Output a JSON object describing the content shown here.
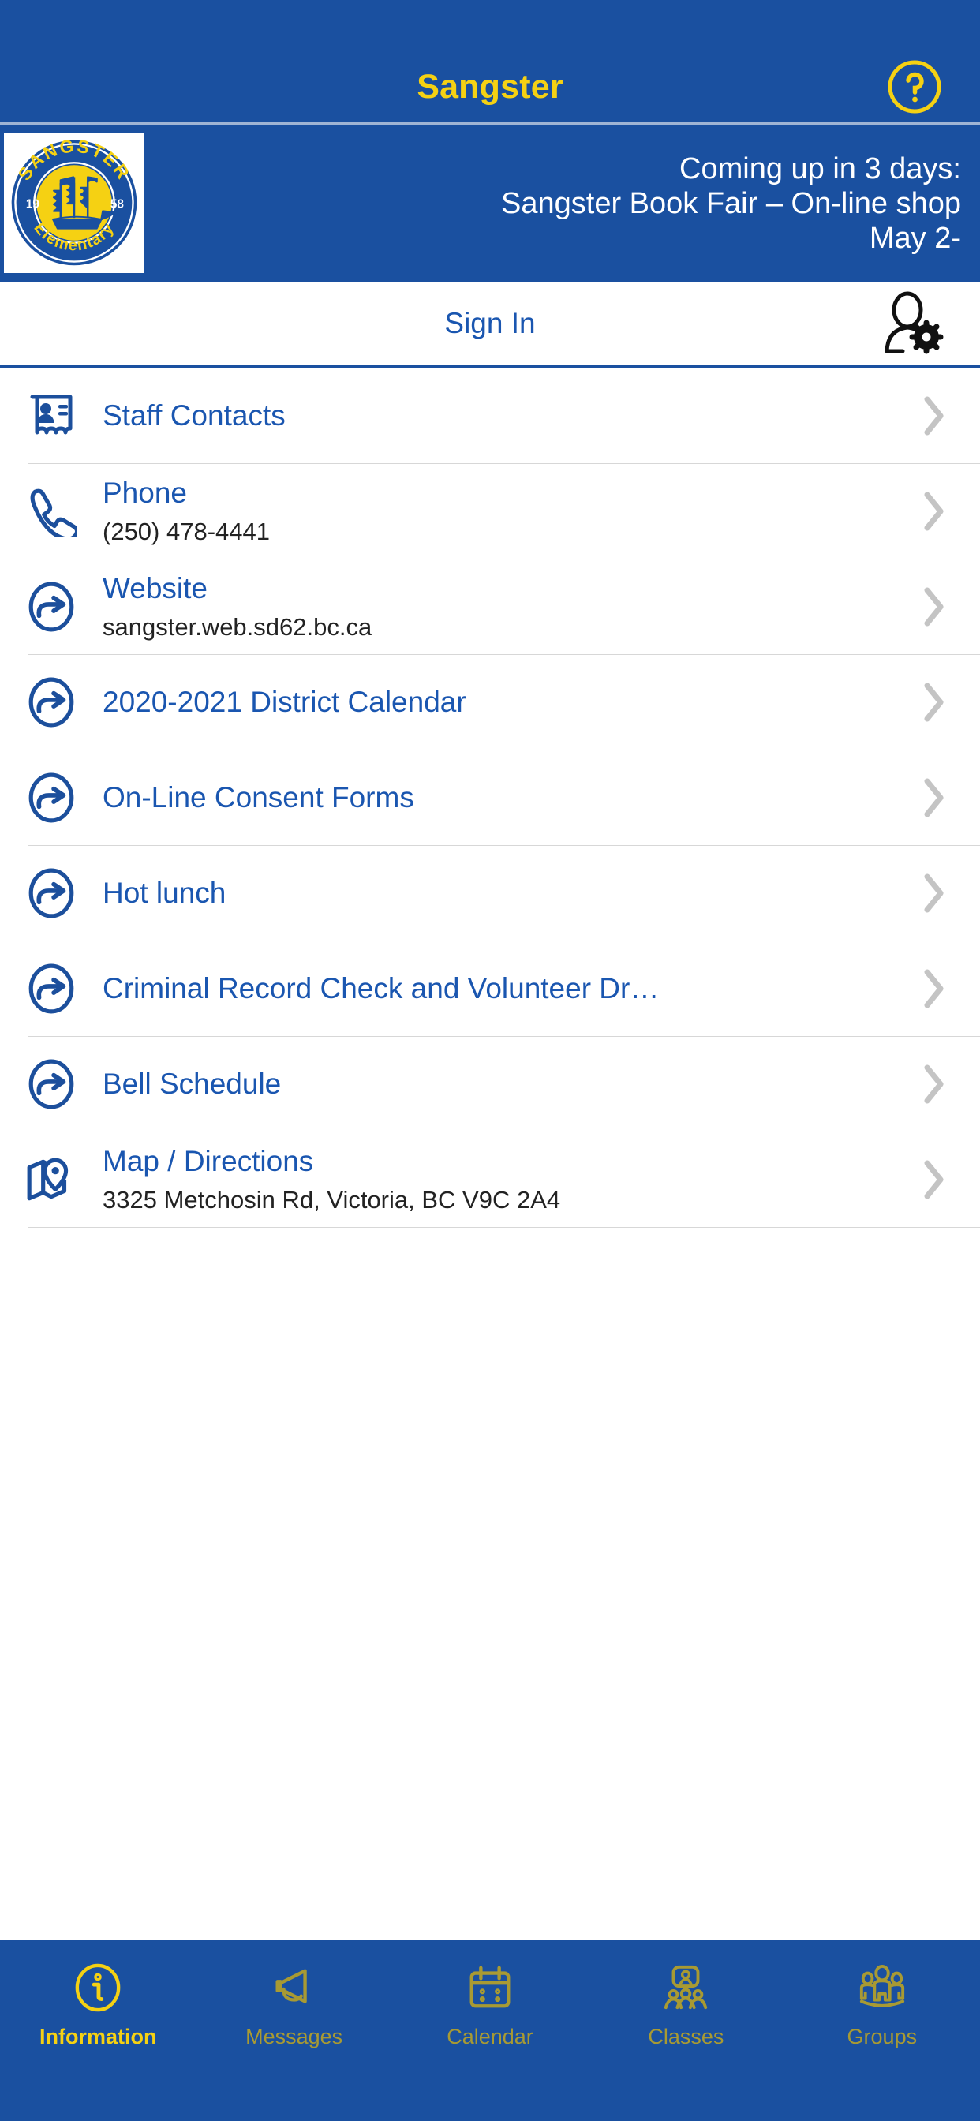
{
  "colors": {
    "brand_blue": "#1a50a0",
    "brand_yellow": "#f5d113",
    "link_blue": "#1a56b0",
    "inactive_tab": "#a89a33",
    "divider": "#d7d7d7"
  },
  "navbar": {
    "title": "Sangster",
    "help_icon": "help-circle-icon"
  },
  "banner": {
    "logo": {
      "name": "sangster-elementary-logo",
      "top_arc_text": "SANGSTER",
      "bottom_arc_text": "Elementary",
      "year_left": "19",
      "year_right": "58",
      "center_icon": "sailing-ship-icon"
    },
    "lines": [
      "Coming up in 3 days:",
      "Sangster Book Fair – On-line shop",
      "May 2-"
    ]
  },
  "signin": {
    "label": "Sign In",
    "avatar_icon": "user-settings-icon"
  },
  "list": {
    "rows": [
      {
        "icon": "contact-card-icon",
        "title": "Staff Contacts",
        "subtitle": ""
      },
      {
        "icon": "phone-icon",
        "title": "Phone",
        "subtitle": "(250) 478-4441"
      },
      {
        "icon": "external-link-icon",
        "title": "Website",
        "subtitle": "sangster.web.sd62.bc.ca"
      },
      {
        "icon": "external-link-icon",
        "title": "2020-2021 District Calendar",
        "subtitle": ""
      },
      {
        "icon": "external-link-icon",
        "title": "On-Line Consent Forms",
        "subtitle": ""
      },
      {
        "icon": "external-link-icon",
        "title": "Hot lunch",
        "subtitle": ""
      },
      {
        "icon": "external-link-icon",
        "title": "Criminal Record Check and Volunteer Dr…",
        "subtitle": ""
      },
      {
        "icon": "external-link-icon",
        "title": "Bell Schedule",
        "subtitle": ""
      },
      {
        "icon": "map-pin-icon",
        "title": "Map / Directions",
        "subtitle": "3325 Metchosin Rd, Victoria, BC V9C 2A4"
      }
    ],
    "chevron": "chevron-right-icon"
  },
  "tabbar": {
    "tabs": [
      {
        "label": "Information",
        "icon": "info-circle-icon",
        "active": true
      },
      {
        "label": "Messages",
        "icon": "megaphone-icon",
        "active": false
      },
      {
        "label": "Calendar",
        "icon": "calendar-icon",
        "active": false
      },
      {
        "label": "Classes",
        "icon": "classes-icon",
        "active": false
      },
      {
        "label": "Groups",
        "icon": "groups-icon",
        "active": false
      }
    ]
  }
}
